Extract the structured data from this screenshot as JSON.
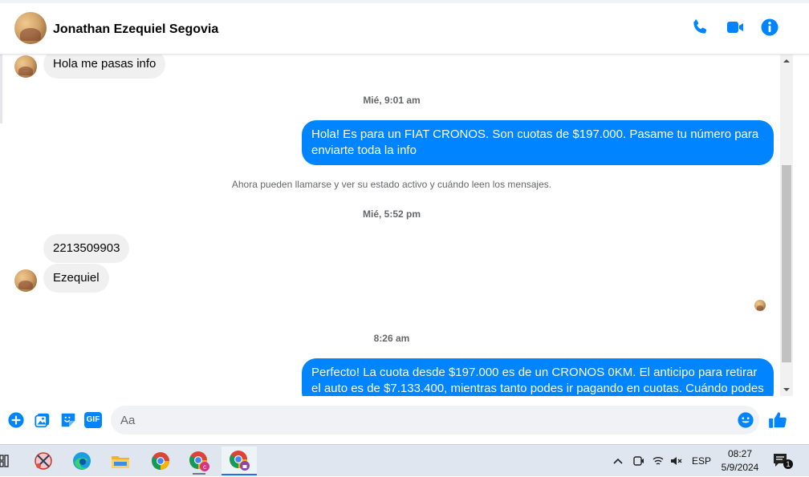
{
  "header": {
    "contact_name": "Jonathan Ezequiel Segovia",
    "icons": [
      "phone-icon",
      "video-camera-icon",
      "info-icon"
    ],
    "accent_color": "#0084ff"
  },
  "messages": {
    "in_1": "Hola me pasas info",
    "time_1": "Mié, 9:01 am",
    "out_1": "Hola! Es para un FIAT CRONOS. Son cuotas de $197.000. Pasame tu número para enviarte toda la info",
    "notice": "Ahora pueden llamarse y ver su estado activo y cuándo leen los mensajes.",
    "time_2": "Mié, 5:52 pm",
    "in_2": "2213509903",
    "in_3": "Ezequiel",
    "time_3": "8:26 am",
    "out_2": "Perfecto! La cuota desde $197.000 es de un CRONOS 0KM. El anticipo para retirar el auto es de $7.133.400, mientras tanto podes ir pagando en cuotas. Cuándo podes"
  },
  "composer": {
    "placeholder": "Aa",
    "icons": [
      "plus-circle-icon",
      "photo-icon",
      "sticker-icon",
      "gif-icon",
      "emoji-icon",
      "thumbs-up-icon"
    ],
    "gif_label": "GIF"
  },
  "taskbar": {
    "apps": [
      "task-view-icon",
      "snipping-tool-icon",
      "edge-icon",
      "file-explorer-icon",
      "chrome-icon",
      "chrome-profile-c-icon",
      "chrome-profile-active-icon"
    ],
    "language": "ESP",
    "time": "08:27",
    "date": "5/9/2024",
    "notification_count": "1"
  }
}
